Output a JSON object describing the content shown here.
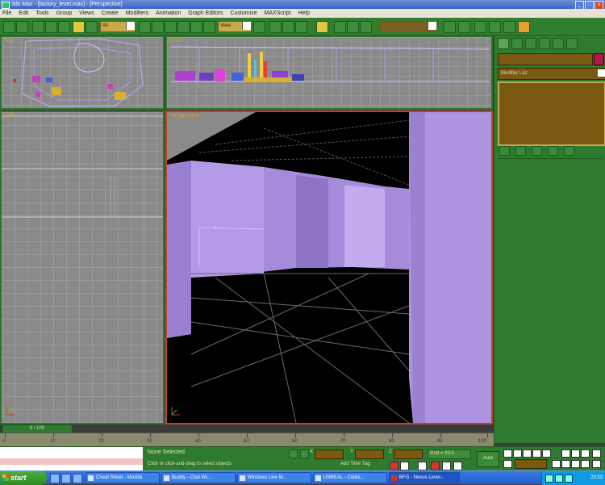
{
  "window": {
    "title": "3ds Max - [factory_level.max] - [Perspective]",
    "buttons": [
      "_",
      "□",
      "x"
    ]
  },
  "menu": [
    "File",
    "Edit",
    "Tools",
    "Group",
    "Views",
    "Create",
    "Modifiers",
    "Animation",
    "Graph Editors",
    "Customize",
    "MAXScript",
    "Help"
  ],
  "toolbar": {
    "selection_filter": "All",
    "reference_coord": "View",
    "named_selection": ""
  },
  "viewports": {
    "top": {
      "label": "Top"
    },
    "front": {
      "label": "Front"
    },
    "left": {
      "label": "Left"
    },
    "perspective": {
      "label": "Perspective"
    }
  },
  "command_panel": {
    "modifier_list": "Modifier List",
    "color_swatch": "#b01a4a"
  },
  "timeline": {
    "slider_label": "0 / 100",
    "ticks": [
      "0",
      "10",
      "20",
      "30",
      "40",
      "50",
      "60",
      "70",
      "80",
      "90",
      "100"
    ]
  },
  "status": {
    "selection": "None Selected",
    "prompt": "Click or click-and-drag to select objects",
    "grid": "Grid = 10.0",
    "add_time_tag": "Add Time Tag",
    "auto_key": "Auto",
    "coord_labels": [
      "X",
      "Y",
      "Z"
    ]
  },
  "taskbar": {
    "start": "start",
    "tasks": [
      "Cheat Sheet - Mozilla",
      "Buddy - Chat Wi...",
      "Windows Live M...",
      "UNREAL - Collisi...",
      "BFG - Nexus Level..."
    ],
    "clock": "23:33"
  },
  "icons": {
    "start_flag": "windows-flag-icon",
    "app": "app-icon"
  }
}
